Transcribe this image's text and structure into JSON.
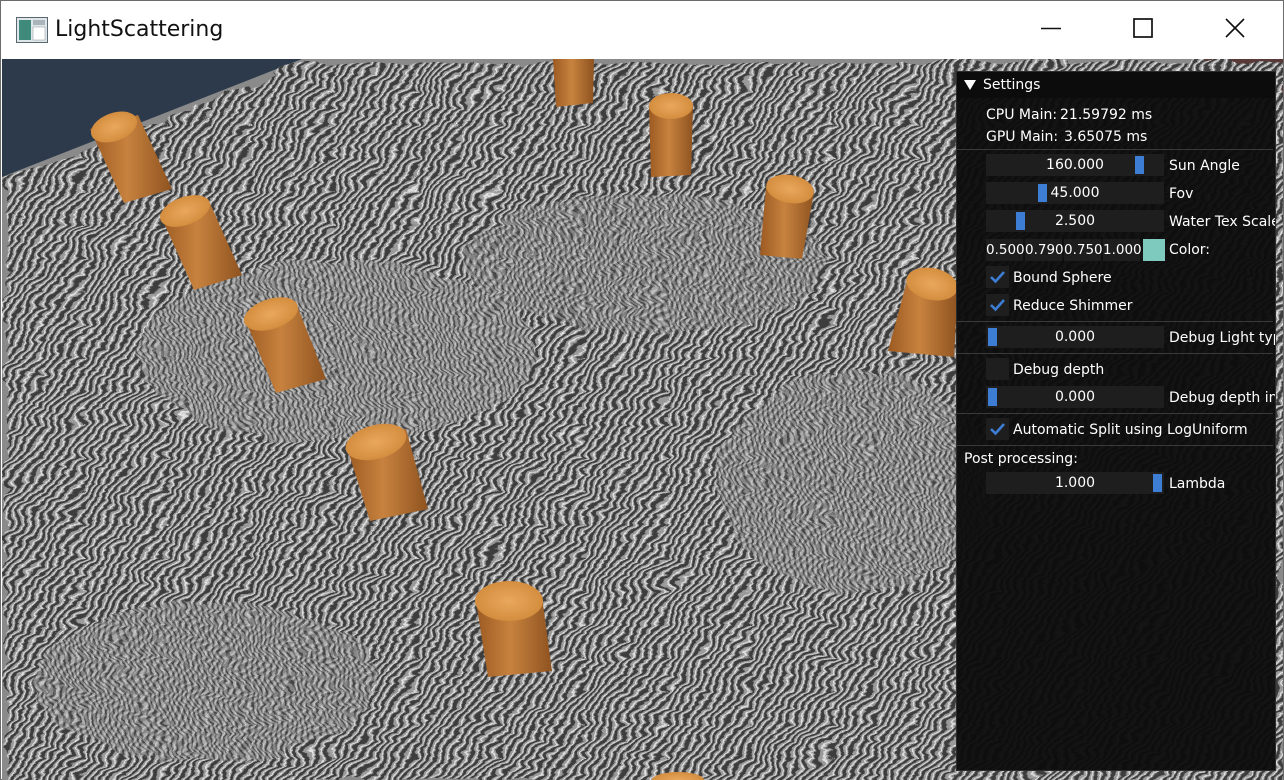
{
  "window": {
    "title": "LightScattering",
    "app_icon": "app-window-icon",
    "minimize_icon": "minimize-icon",
    "maximize_icon": "maximize-icon",
    "close_icon": "close-icon"
  },
  "colors": {
    "slider_grab": "#3d7dd4",
    "frame_bg": "#1e1e1e",
    "panel_bg": "#0c0c0c",
    "swatch": "#7ecabf",
    "check": "#3d7dd4",
    "wood": "#c27a35"
  },
  "settings": {
    "header": "Settings",
    "cpu_label": "CPU Main:",
    "cpu_value": "21.59792 ms",
    "gpu_label": "GPU Main:",
    "gpu_value": "3.65075 ms",
    "sun_angle": {
      "value": "160.000",
      "label": "Sun Angle",
      "fraction": 0.89
    },
    "fov": {
      "value": "45.000",
      "label": "Fov",
      "fraction": 0.3
    },
    "water_tex_scale": {
      "value": "2.500",
      "label": "Water Tex Scale",
      "fraction": 0.17
    },
    "color": {
      "r": "0.500",
      "g": "0.790",
      "b": "0.750",
      "a": "1.000",
      "label": "Color:"
    },
    "bound_sphere": {
      "label": "Bound Sphere",
      "checked": true
    },
    "reduce_shimmer": {
      "label": "Reduce Shimmer",
      "checked": true
    },
    "debug_light_type": {
      "value": "0.000",
      "label": "Debug Light type",
      "fraction": 0.0
    },
    "debug_depth": {
      "label": "Debug depth",
      "checked": false
    },
    "debug_depth_index": {
      "value": "0.000",
      "label": "Debug depth inde",
      "fraction": 0.0
    },
    "automatic_split": {
      "label": "Automatic Split using LogUniform",
      "checked": true
    },
    "post_processing": "Post processing:",
    "lambda": {
      "value": "1.000",
      "label": "Lambda",
      "fraction": 1.0
    }
  }
}
